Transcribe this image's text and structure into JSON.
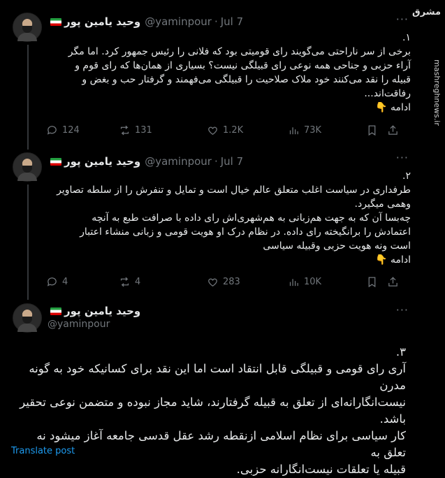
{
  "tweets": [
    {
      "display_name": "وحید یامین پور",
      "handle": "@yaminpour",
      "date": "Jul 7",
      "lines": [
        "۱.",
        "برخی از سر ناراحتی می‌گویند رای قومیتی بود که فلانی را رئیس جمهور کرد. اما مگر",
        "آراء حزبی و جناحی همه نوعی رای قبیلگی نیست؟ بسیاری از همان‌ها که رای قوم و",
        "قبیله را نقد می‌کنند خود ملاک صلاحیت را قبیلگی می‌فهمند و گرفتار حب و بغض و",
        "رفاقت‌اند...",
        "ادامه 👇"
      ],
      "replies": "124",
      "reposts": "131",
      "likes": "1.2K",
      "views": "73K"
    },
    {
      "display_name": "وحید یامین پور",
      "handle": "@yaminpour",
      "date": "Jul 7",
      "lines": [
        "۲.",
        "طرفداری در سیاست اغلب متعلق عالم خیال است و تمایل و تنفرش را از سلطه تصاویر",
        "وهمی میگیرد.",
        "چه‌بسا آن که به جهت هم‌زبانی به هم‌شهری‌اش رای داده با صرافت طبع به آنچه",
        "اعتمادش را برانگیخته رای داده. در نظام درک او هویت قومی و زبانی منشاء اعتبار",
        "است ونه هویت حزبی وقبیله سیاسی",
        "ادامه 👇"
      ],
      "replies": "4",
      "reposts": "4",
      "likes": "283",
      "views": "10K"
    }
  ],
  "main_tweet": {
    "display_name": "وحید یامین پور",
    "handle": "@yaminpour",
    "lines": [
      "۳.",
      "آری رای قومی و قبیلگی قابل انتقاد است اما این نقد برای کسانیکه خود به گونه مدرن",
      "نیست‌انگارانه‌ای از تعلق به قبیله گرفتارند، شاید مجاز نبوده و متضمن نوعی تحقیر",
      "باشد.",
      "کار سیاسی برای نظام اسلامی ازنقطه رشد عقل قدسی جامعه آغاز میشود نه تعلق به",
      "قبیله یا تعلقات نیست‌انگارانه حزبی."
    ],
    "translate_label": "Translate post"
  },
  "watermark": {
    "logo": "مشرق",
    "url": "mashreghnews.ir"
  },
  "icons": [
    "reply-icon",
    "repost-icon",
    "like-icon",
    "views-icon",
    "bookmark-icon",
    "share-icon",
    "more-icon"
  ]
}
